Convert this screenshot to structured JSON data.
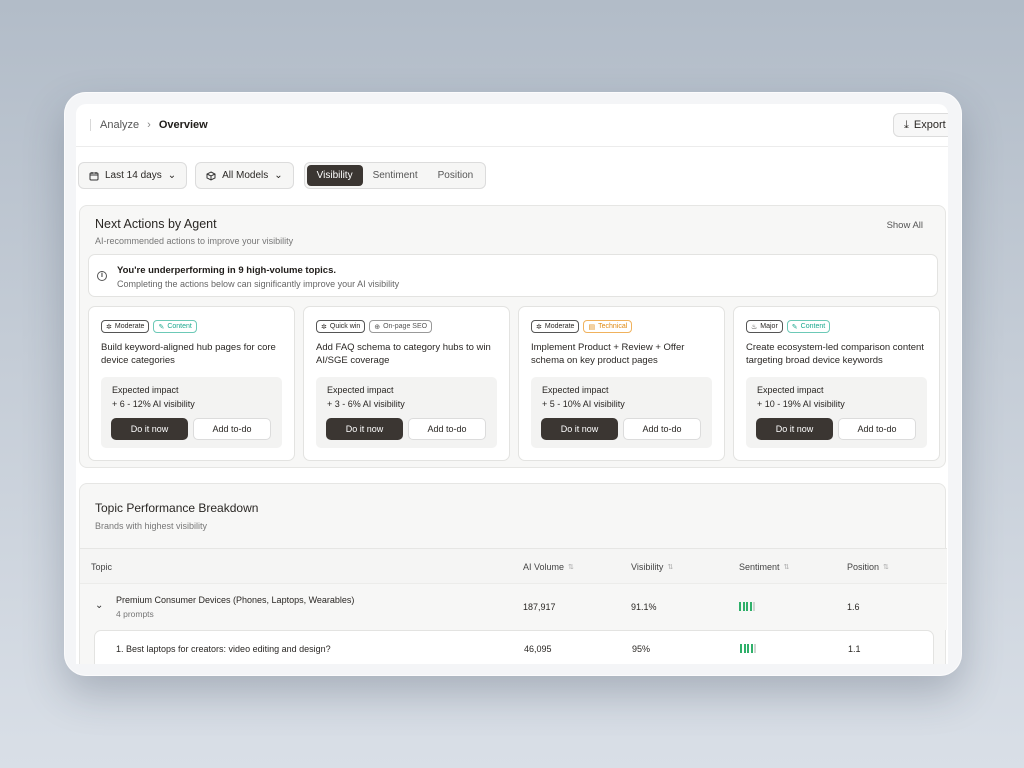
{
  "breadcrumb": {
    "parent": "Analyze",
    "separator": "›",
    "current": "Overview"
  },
  "header": {
    "export_label": "Export"
  },
  "filters": {
    "date_range": "Last 14 days",
    "models": "All Models",
    "tabs": [
      "Visibility",
      "Sentiment",
      "Position"
    ],
    "active_tab": "Visibility"
  },
  "next_actions": {
    "title": "Next Actions by Agent",
    "subtitle": "AI-recommended actions to improve your visibility",
    "show_all": "Show All",
    "alert_title": "You're underperforming in 9 high-volume topics.",
    "alert_subtitle": "Completing the actions below can significantly improve your AI visibility",
    "impact_label": "Expected impact",
    "do_label": "Do it now",
    "todo_label": "Add to-do",
    "cards": [
      {
        "effort": "Moderate",
        "category": "Content",
        "title": "Build keyword-aligned hub pages for core device categories",
        "impact": "+ 6 - 12% AI visibility"
      },
      {
        "effort": "Quick win",
        "category": "On-page SEO",
        "title": "Add FAQ schema to category hubs to win AI/SGE coverage",
        "impact": "+ 3 - 6% AI visibility"
      },
      {
        "effort": "Moderate",
        "category": "Technical",
        "title": "Implement Product + Review + Offer schema on key product pages",
        "impact": "+ 5 - 10% AI visibility"
      },
      {
        "effort": "Major",
        "category": "Content",
        "title": "Create ecosystem-led comparison content targeting broad device keywords",
        "impact": "+ 10 - 19% AI visibility"
      }
    ]
  },
  "topic_performance": {
    "title": "Topic Performance Breakdown",
    "subtitle": "Brands with highest visibility",
    "columns": [
      "Topic",
      "AI Volume",
      "Visibility",
      "Sentiment",
      "Position"
    ],
    "rows": [
      {
        "topic": "Premium Consumer Devices (Phones, Laptops, Wearables)",
        "prompts": "4 prompts",
        "ai_volume": "187,917",
        "visibility": "91.1%",
        "sentiment_level": 0.8,
        "position": "1.6"
      }
    ],
    "child_rows": [
      {
        "topic": "1.  Best laptops for creators: video editing and design?",
        "ai_volume": "46,095",
        "visibility": "95%",
        "sentiment_level": 0.8,
        "position": "1.1"
      }
    ]
  },
  "colors": {
    "primary": "#3b3632",
    "sentiment_on": "#2fb06a",
    "content_tag": "#1aa88e",
    "technical_tag": "#e08a12"
  }
}
